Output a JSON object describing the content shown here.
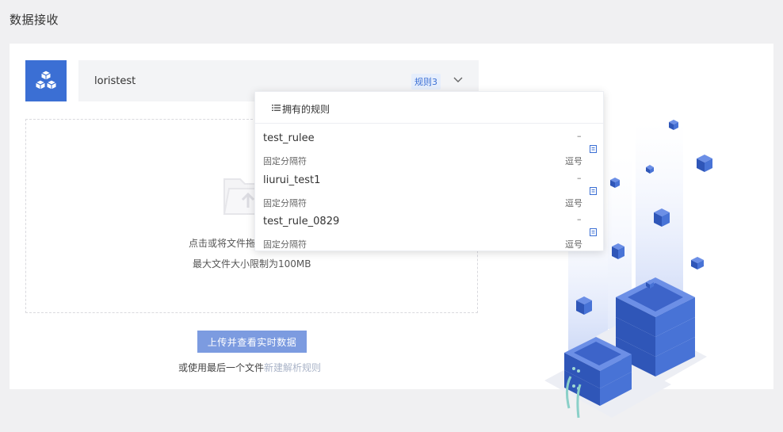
{
  "page": {
    "title": "数据接收"
  },
  "selector": {
    "name": "loristest",
    "rule_badge": "规则3"
  },
  "dropzone": {
    "hint_line1": "点击或将文件拖",
    "hint_line2": "最大文件大小限制为100MB"
  },
  "upload_button": "上传并查看实时数据",
  "bottom": {
    "prefix": "或使用最后一个文件",
    "link": "新建解析规则"
  },
  "dropdown": {
    "header": "拥有的规则",
    "items": [
      {
        "name": "test_rulee",
        "dash": "–",
        "separator_label": "固定分隔符",
        "separator_value": "逗号"
      },
      {
        "name": "liurui_test1",
        "dash": "–",
        "separator_label": "固定分隔符",
        "separator_value": "逗号"
      },
      {
        "name": "test_rule_0829",
        "dash": "–",
        "separator_label": "固定分隔符",
        "separator_value": "逗号"
      }
    ]
  },
  "colors": {
    "accent": "#3b6fd4",
    "button": "#7c9be0",
    "background": "#f0f0f2"
  }
}
